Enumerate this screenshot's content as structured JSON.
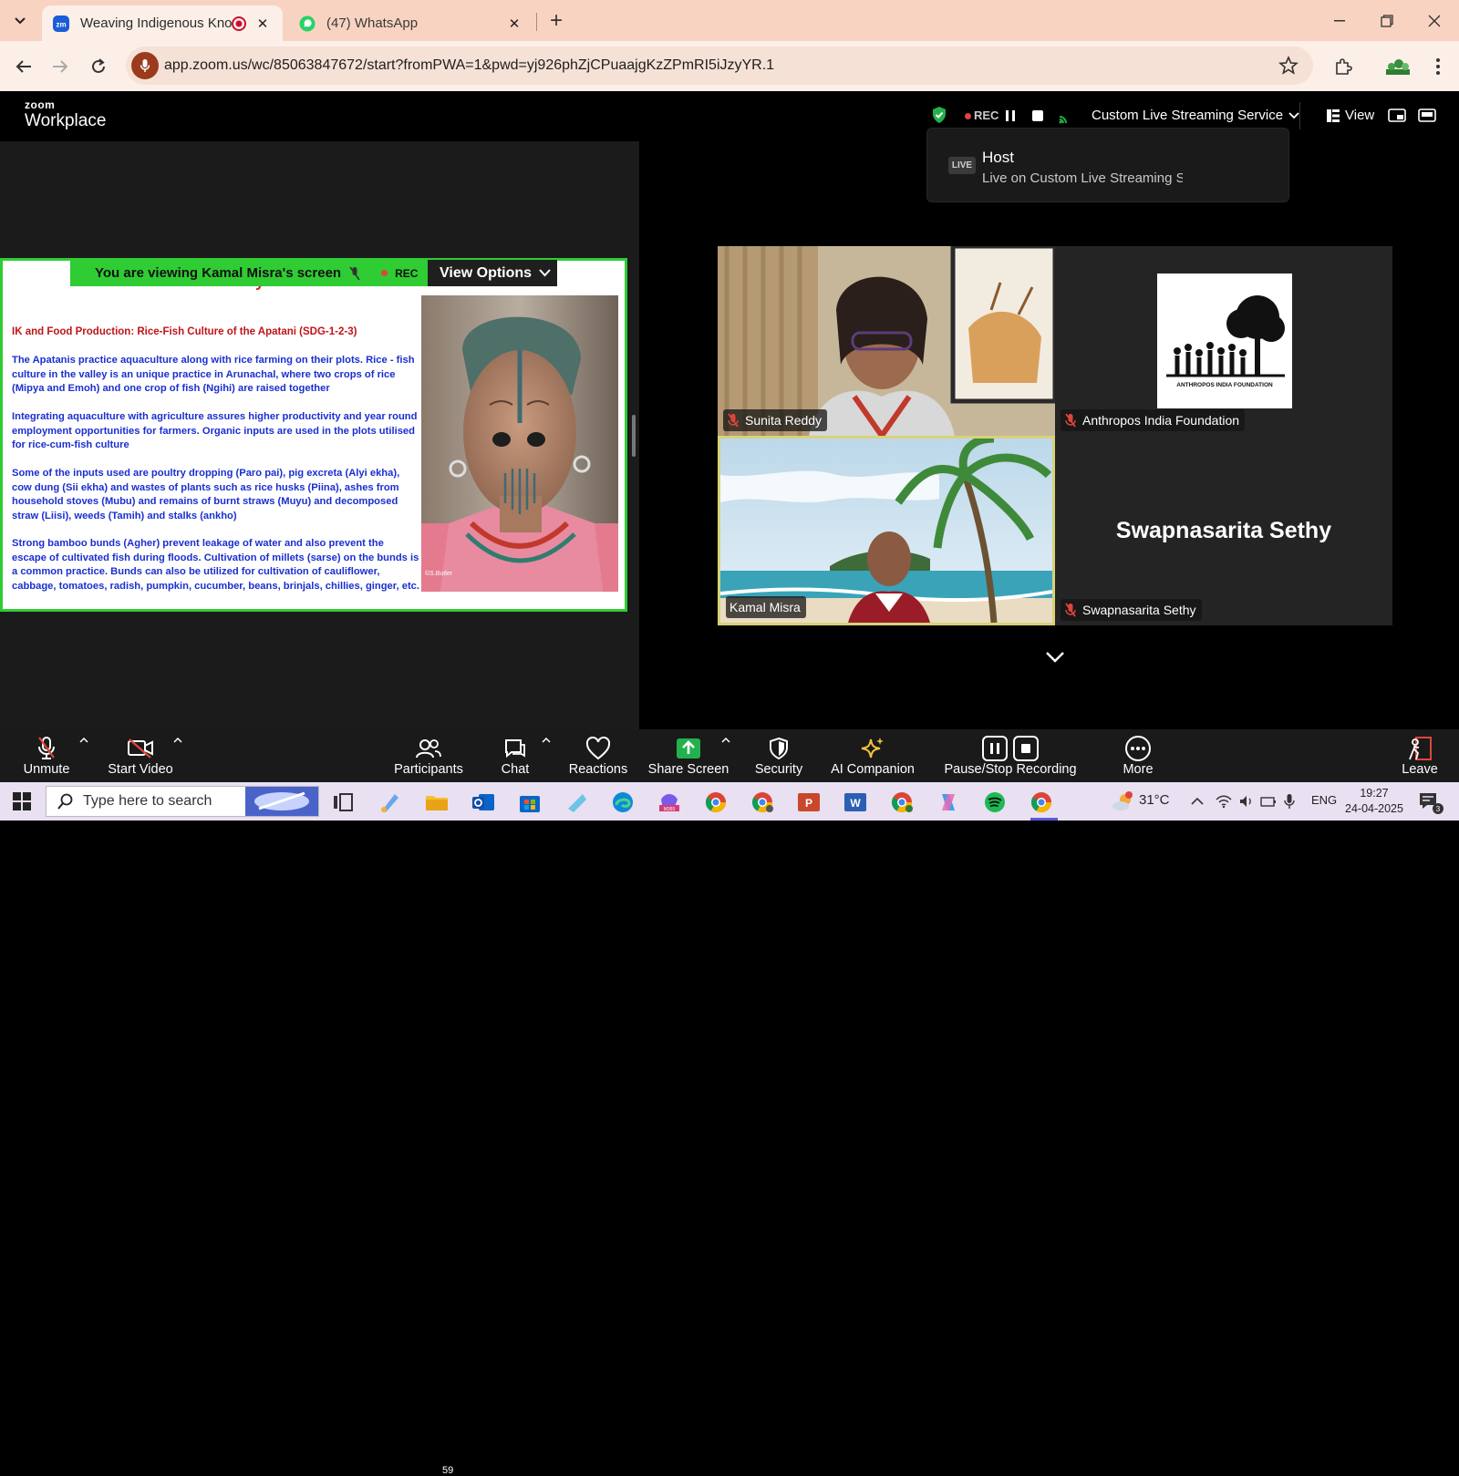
{
  "browser": {
    "tabs": [
      {
        "title": "Weaving Indigenous Knowle",
        "active": true,
        "favicon": "zoom-icon"
      },
      {
        "title": "(47) WhatsApp",
        "active": false,
        "favicon": "whatsapp-icon"
      }
    ],
    "url": "app.zoom.us/wc/85063847672/start?fromPWA=1&pwd=yj926phZjCPuaajgKzZPmRI5iJzyYR.1"
  },
  "zoom": {
    "brand_small": "zoom",
    "brand_big": "Workplace",
    "rec_label": "REC",
    "stream_service": "Custom Live Streaming Service",
    "view_label": "View",
    "live_popup": {
      "badge": "LIVE",
      "title": "Host",
      "subtitle": "Live on Custom Live Streaming Se"
    },
    "share_banner": {
      "text": "You are viewing  Kamal Misra's screen",
      "rec": "REC",
      "view_options": "View Options"
    },
    "slide": {
      "title": "IK and Sustainability ... ",
      "title_italic": "contd.",
      "heading": "IK and Food Production: Rice-Fish Culture of the Apatani (SDG-1-2-3)",
      "paragraphs": [
        "The Apatanis practice aquaculture along with rice farming on their plots. Rice - fish culture in the valley is an unique practice in Arunachal, where two crops of rice (Mipya and Emoh) and one crop of fish (Ngihi) are raised together",
        "Integrating aquaculture with agriculture assures higher productivity and year round employment opportunities for farmers. Organic inputs are used in the plots utilised for rice-cum-fish culture",
        "Some of the inputs used are poultry dropping (Paro pai), pig excreta (Alyi ekha), cow dung (Sii ekha) and wastes of plants such as rice husks (Piina), ashes from household stoves (Mubu) and remains of burnt straws (Muyu) and decomposed straw (Liisi), weeds (Tamih) and stalks (ankho)",
        "Strong bamboo bunds (Agher) prevent leakage of water and also prevent the escape of cultivated fish during floods. Cultivation of millets (sarse) on the bunds is a common practice. Bunds can also be utilized for cultivation of cauliflower, cabbage, tomatoes, radish, pumpkin, cucumber, beans, brinjals, chillies, ginger, etc."
      ],
      "photo_credit": "©S.Butler"
    },
    "participants_tiles": [
      {
        "name": "Sunita Reddy",
        "muted": true
      },
      {
        "name": "Anthropos India Foundation",
        "muted": true,
        "logo_text": "ANTHROPOS INDIA FOUNDATION"
      },
      {
        "name": "Kamal Misra",
        "muted": false
      },
      {
        "name": "Swapnasarita Sethy",
        "muted": true,
        "big_name": "Swapnasarita Sethy"
      }
    ],
    "toolbar": {
      "unmute": "Unmute",
      "start_video": "Start Video",
      "participants": "Participants",
      "participants_count": "59",
      "chat": "Chat",
      "reactions": "Reactions",
      "share_screen": "Share Screen",
      "security": "Security",
      "ai_companion": "AI Companion",
      "pause_stop": "Pause/Stop Recording",
      "more": "More",
      "leave": "Leave"
    }
  },
  "taskbar": {
    "search_placeholder": "Type here to search",
    "weather": "31°C",
    "lang": "ENG",
    "time": "19:27",
    "date": "24-04-2025",
    "notifications": "3"
  },
  "colors": {
    "share_border": "#2fcc34",
    "rec_red": "#e0453a",
    "slide_blue": "#1a2fd0",
    "slide_red": "#c0141a",
    "tab_bar": "#f9d3c2"
  }
}
